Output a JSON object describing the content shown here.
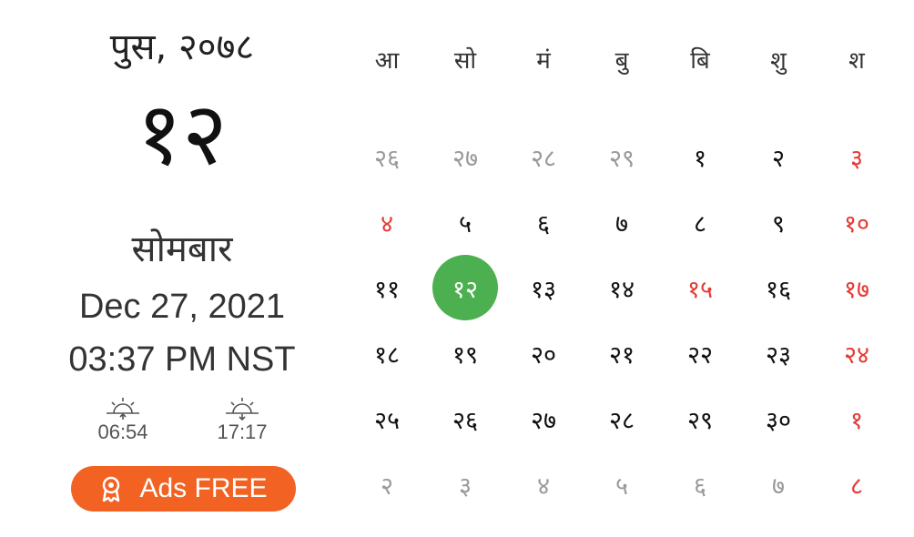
{
  "left_panel": {
    "month_year": "पुस, २०७८",
    "nepali_day": "१२",
    "weekday": "सोमबार",
    "gregorian_date": "Dec 27, 2021",
    "time": "03:37 PM NST",
    "sunrise": "06:54",
    "sunset": "17:17",
    "ads_label": "Ads FREE",
    "ads_color": "#f26222"
  },
  "calendar": {
    "weekdays": [
      "आ",
      "सो",
      "मं",
      "बु",
      "बि",
      "शु",
      "श"
    ],
    "weeks": [
      [
        {
          "d": "२६",
          "s": "muted"
        },
        {
          "d": "२७",
          "s": "muted"
        },
        {
          "d": "२८",
          "s": "muted"
        },
        {
          "d": "२९",
          "s": "muted"
        },
        {
          "d": "१",
          "s": ""
        },
        {
          "d": "२",
          "s": ""
        },
        {
          "d": "३",
          "s": "holiday"
        }
      ],
      [
        {
          "d": "४",
          "s": "holiday"
        },
        {
          "d": "५",
          "s": ""
        },
        {
          "d": "६",
          "s": ""
        },
        {
          "d": "७",
          "s": ""
        },
        {
          "d": "८",
          "s": ""
        },
        {
          "d": "९",
          "s": ""
        },
        {
          "d": "१०",
          "s": "holiday"
        }
      ],
      [
        {
          "d": "११",
          "s": ""
        },
        {
          "d": "१२",
          "s": "today"
        },
        {
          "d": "१३",
          "s": ""
        },
        {
          "d": "१४",
          "s": ""
        },
        {
          "d": "१५",
          "s": "holiday"
        },
        {
          "d": "१६",
          "s": ""
        },
        {
          "d": "१७",
          "s": "holiday"
        }
      ],
      [
        {
          "d": "१८",
          "s": ""
        },
        {
          "d": "१९",
          "s": ""
        },
        {
          "d": "२०",
          "s": ""
        },
        {
          "d": "२१",
          "s": ""
        },
        {
          "d": "२२",
          "s": ""
        },
        {
          "d": "२३",
          "s": ""
        },
        {
          "d": "२४",
          "s": "holiday"
        }
      ],
      [
        {
          "d": "२५",
          "s": ""
        },
        {
          "d": "२६",
          "s": ""
        },
        {
          "d": "२७",
          "s": ""
        },
        {
          "d": "२८",
          "s": ""
        },
        {
          "d": "२९",
          "s": ""
        },
        {
          "d": "३०",
          "s": ""
        },
        {
          "d": "१",
          "s": "holiday"
        }
      ],
      [
        {
          "d": "२",
          "s": "muted"
        },
        {
          "d": "३",
          "s": "muted"
        },
        {
          "d": "४",
          "s": "muted"
        },
        {
          "d": "५",
          "s": "muted"
        },
        {
          "d": "६",
          "s": "muted"
        },
        {
          "d": "७",
          "s": "muted"
        },
        {
          "d": "८",
          "s": "holiday"
        }
      ]
    ],
    "today_color": "#4caf50",
    "holiday_color": "#e53935"
  }
}
